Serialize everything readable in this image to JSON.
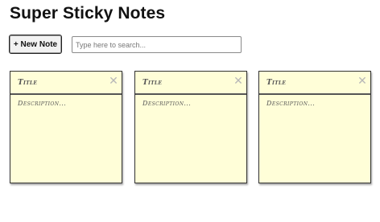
{
  "header": {
    "title": "Super Sticky Notes"
  },
  "toolbar": {
    "new_note_label": "+ New Note",
    "search_placeholder": "Type here to search...",
    "search_value": ""
  },
  "notes": [
    {
      "title_placeholder": "Title",
      "description_placeholder": "Description...",
      "close_glyph": "✕"
    },
    {
      "title_placeholder": "Title",
      "description_placeholder": "Description...",
      "close_glyph": "✕"
    },
    {
      "title_placeholder": "Title",
      "description_placeholder": "Description...",
      "close_glyph": "✕"
    }
  ],
  "colors": {
    "note_background": "#fffed8",
    "note_border": "#333333",
    "close_icon": "#b8b8b8"
  },
  "icons": {
    "close": "close-icon"
  }
}
